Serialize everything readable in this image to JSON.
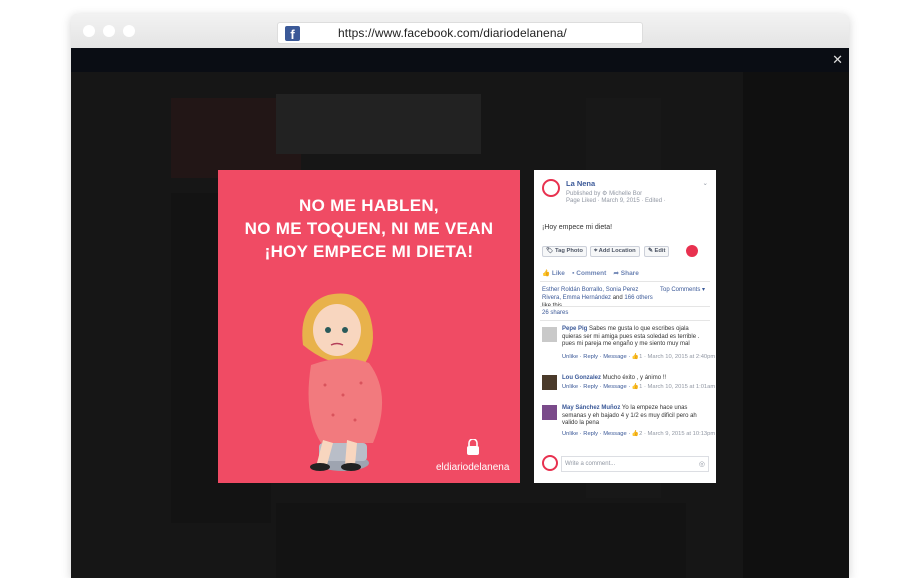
{
  "browser": {
    "url": "https://www.facebook.com/diariodelanena/"
  },
  "post": {
    "page_name": "La Nena",
    "published_by": "Published by",
    "author": "Michelle Bor",
    "page_liked": "Page Liked · March 9, 2015 · Edited ·",
    "text": "¡Hoy empece mi dieta!",
    "tag_photo": "Tag Photo",
    "add_location": "Add Location",
    "edit": "Edit",
    "like": "Like",
    "comment": "Comment",
    "share": "Share",
    "likes_text_names": "Esther Roldán Borrallo, Sonia Perez Rivera, Emma Hernández",
    "likes_text_and": "and",
    "likes_text_others": "166 others",
    "likes_text_tail": "like this.",
    "top_comments": "Top Comments ▾",
    "shares": "26 shares",
    "write_placeholder": "Write a comment..."
  },
  "photo": {
    "headline_1": "NO ME HABLEN,",
    "headline_2": "NO ME TOQUEN, NI ME VEAN",
    "headline_3": "¡HOY EMPECE MI DIETA!",
    "brand": "eldiariodelanena"
  },
  "comments": [
    {
      "name": "Pepe Pig",
      "text": "Sabes me gusta lo que escribes ojala quieras ser mi amiga pues esta soledad es terrible . pues mi pareja me engaño y me siento muy mal",
      "actions": "Unlike · Reply · Message ·",
      "likes": "1",
      "date": "· March 10, 2015 at 2:40pm"
    },
    {
      "name": "Lou Gonzalez",
      "text": "Mucho éxito , y ánimo !!",
      "actions": "Unlike · Reply · Message ·",
      "likes": "1",
      "date": "· March 10, 2015 at 1:01am"
    },
    {
      "name": "May Sánchez Muñoz",
      "text": "Yo la empeze hace unas semanas y eh bajado 4 y 1/2 es muy dificil pero ah valido la pena",
      "actions": "Unlike · Reply · Message ·",
      "likes": "2",
      "date": "· March 9, 2015 at 10:13pm"
    }
  ],
  "colors": {
    "accent": "#f04b64",
    "facebook_blue": "#3b5998"
  }
}
